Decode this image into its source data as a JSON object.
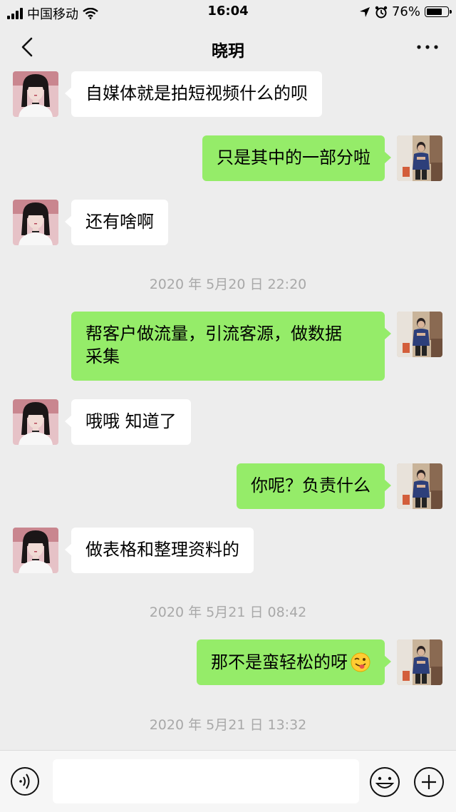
{
  "status_bar": {
    "carrier": "中国移动",
    "time": "16:04",
    "battery": "76%",
    "battery_level": 0.76,
    "icons": [
      "signal-icon",
      "wifi-icon",
      "location-icon",
      "alarm-icon",
      "battery-icon"
    ]
  },
  "header": {
    "title": "晓玥",
    "icons": [
      "back-icon",
      "more-icon"
    ]
  },
  "messages": [
    {
      "side": "in",
      "text": "自媒体就是拍短视频什么的呗"
    },
    {
      "side": "out",
      "text": "只是其中的一部分啦"
    },
    {
      "side": "in",
      "text": "还有啥啊"
    },
    {
      "timestamp": "2020 年 5月20 日 22:20"
    },
    {
      "side": "out",
      "text_line1": "帮客户做流量，引流客源，做数据",
      "text_line2": "采集"
    },
    {
      "side": "in",
      "text": "哦哦 知道了"
    },
    {
      "side": "out",
      "text": "你呢？负责什么"
    },
    {
      "side": "in",
      "text": "做表格和整理资料的"
    },
    {
      "timestamp": "2020 年 5月21 日 08:42"
    },
    {
      "side": "out",
      "text": "那不是蛮轻松的呀",
      "emoji": "winking-face-with-tongue-icon"
    },
    {
      "timestamp": "2020 年 5月21 日 13:32"
    }
  ],
  "input_bar": {
    "placeholder": "",
    "icons": [
      "voice-icon",
      "emoji-icon",
      "plus-icon"
    ]
  },
  "colors": {
    "background": "#ededed",
    "outgoing_bubble": "#95ec69",
    "incoming_bubble": "#ffffff",
    "timestamp_text": "#a8a8a8"
  }
}
